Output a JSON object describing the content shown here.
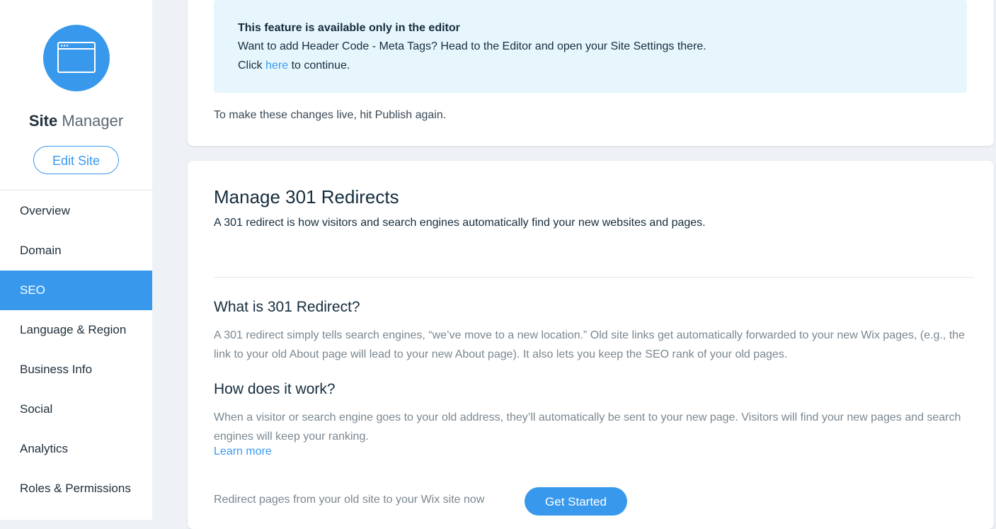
{
  "sidebar": {
    "icon": "browser-window-icon",
    "title_bold": "Site",
    "title_light": "Manager",
    "edit_button": "Edit Site",
    "items": [
      {
        "label": "Overview"
      },
      {
        "label": "Domain"
      },
      {
        "label": "SEO",
        "active": true
      },
      {
        "label": "Language & Region"
      },
      {
        "label": "Business Info"
      },
      {
        "label": "Social"
      },
      {
        "label": "Analytics"
      },
      {
        "label": "Roles & Permissions"
      }
    ]
  },
  "notice": {
    "title": "This feature is available only in the editor",
    "line1": "Want to add Header Code - Meta Tags? Head to the Editor and open your Site Settings there.",
    "line2_prefix": "Click ",
    "line2_link": "here",
    "line2_suffix": " to continue.",
    "publish_note": "To make these changes live, hit Publish again."
  },
  "redirects": {
    "heading": "Manage 301 Redirects",
    "description": "A 301 redirect is how visitors and search engines automatically find your new websites and pages.",
    "what_heading": "What is 301 Redirect?",
    "what_text": "A 301 redirect simply tells search engines, “we’ve move to a new location.” Old site links get automatically forwarded to your new Wix pages, (e.g., the link to your old About page will lead to your new About page). It also lets you keep the SEO rank of your old pages.",
    "how_heading": "How does it work?",
    "how_text": "When a visitor or search engine goes to your old address, they’ll automatically be sent to your new page. Visitors will find your new pages and search engines will keep your ranking.",
    "learn_more": "Learn more",
    "cta_text": "Redirect pages from your old site to your Wix site now",
    "cta_button": "Get Started"
  },
  "colors": {
    "accent": "#3899ec",
    "notice_bg": "#e7f6fd",
    "page_bg": "#eef1f5"
  }
}
